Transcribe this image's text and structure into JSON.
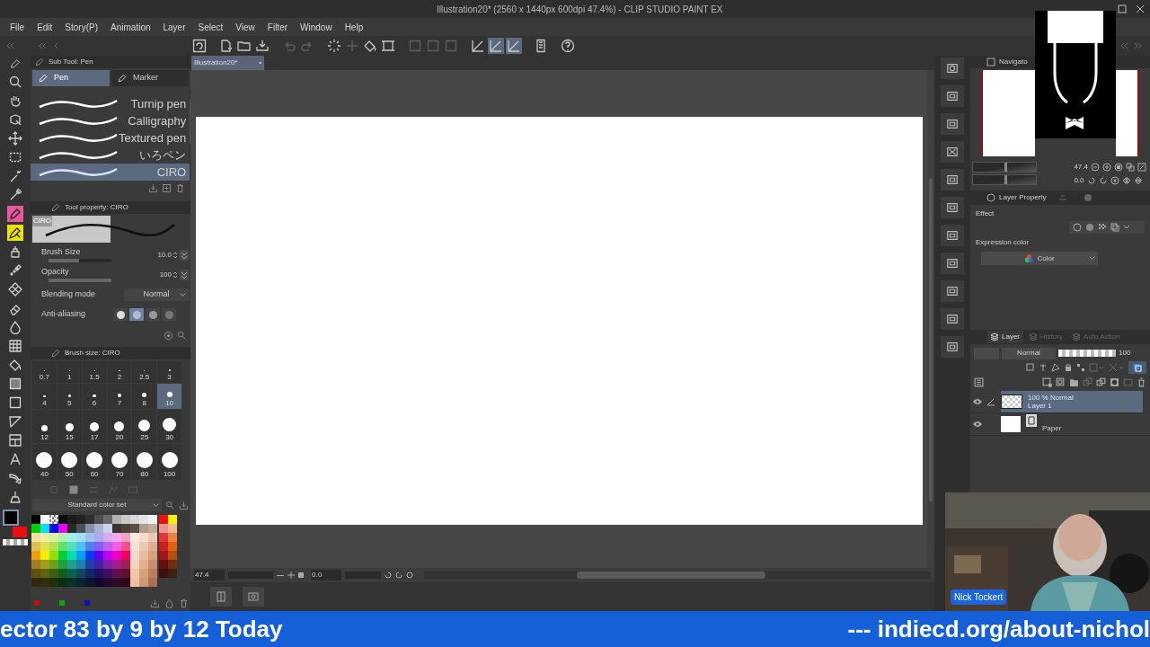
{
  "title_bar": {
    "title": "Illustration20* (2560 x 1440px 600dpi 47.4%) - CLIP STUDIO PAINT EX"
  },
  "menu": [
    "File",
    "Edit",
    "Story(P)",
    "Animation",
    "Layer",
    "Select",
    "View",
    "Filter",
    "Window",
    "Help"
  ],
  "command_bar": [
    {
      "kind": "logo",
      "disabled": false,
      "selected": false
    },
    {
      "kind": "new",
      "disabled": false,
      "selected": false
    },
    {
      "kind": "open",
      "disabled": false,
      "selected": false
    },
    {
      "kind": "save",
      "disabled": false,
      "selected": false
    },
    {
      "kind": "undo",
      "disabled": true,
      "selected": false
    },
    {
      "kind": "redo",
      "disabled": true,
      "selected": false
    },
    {
      "kind": "spinner",
      "disabled": false,
      "selected": false
    },
    {
      "kind": "cross",
      "disabled": true,
      "selected": false
    },
    {
      "kind": "fill",
      "disabled": false,
      "selected": false
    },
    {
      "kind": "selbox",
      "disabled": false,
      "selected": false
    },
    {
      "kind": "rect",
      "disabled": true,
      "selected": false
    },
    {
      "kind": "rect",
      "disabled": true,
      "selected": false
    },
    {
      "kind": "rect",
      "disabled": true,
      "selected": false
    },
    {
      "kind": "ruler",
      "disabled": false,
      "selected": false
    },
    {
      "kind": "ruler",
      "disabled": false,
      "selected": true
    },
    {
      "kind": "ruler",
      "disabled": false,
      "selected": true
    },
    {
      "kind": "device",
      "disabled": false,
      "selected": false
    },
    {
      "kind": "help",
      "disabled": false,
      "selected": false
    }
  ],
  "tools": [
    {
      "kind": "zoom"
    },
    {
      "kind": "hand"
    },
    {
      "kind": "object"
    },
    {
      "kind": "move"
    },
    {
      "kind": "select"
    },
    {
      "kind": "wand"
    },
    {
      "kind": "dropper"
    },
    {
      "kind": "pen",
      "color": "#e8589c"
    },
    {
      "kind": "pencil",
      "color": "#e8e010"
    },
    {
      "kind": "airbrush"
    },
    {
      "kind": "deco"
    },
    {
      "kind": "pattern"
    },
    {
      "kind": "eraser"
    },
    {
      "kind": "blend"
    },
    {
      "kind": "ruler"
    },
    {
      "kind": "fill"
    },
    {
      "kind": "gradient"
    },
    {
      "kind": "rect"
    },
    {
      "kind": "triangle"
    },
    {
      "kind": "frame"
    },
    {
      "kind": "text"
    },
    {
      "kind": "balloon"
    },
    {
      "kind": "correction"
    }
  ],
  "main_color": {
    "color": "#000000"
  },
  "sub_color": {
    "color": "#e81010"
  },
  "sub_tool": {
    "title": "Sub Tool: Pen",
    "tabs": [
      {
        "label": "Pen",
        "selected": true
      },
      {
        "label": "Marker",
        "selected": false
      }
    ],
    "brushes": [
      {
        "name": "Turnip pen",
        "selected": false
      },
      {
        "name": "Calligraphy",
        "selected": false
      },
      {
        "name": "Textured pen",
        "selected": false
      },
      {
        "name": "いろペン",
        "selected": false
      },
      {
        "name": "CIRO",
        "selected": true
      }
    ]
  },
  "tool_property": {
    "title": "Tool property: CIRO",
    "preview_label": "CIRO",
    "properties": [
      {
        "kind": "slider",
        "label": "Brush Size",
        "value": "10.0",
        "level": 0.48
      },
      {
        "kind": "slider",
        "label": "Opacity",
        "value": "100",
        "level": 1
      },
      {
        "kind": "dropdown",
        "label": "Blending mode",
        "value": "Normal"
      },
      {
        "kind": "options",
        "label": "Anti-aliasing",
        "options": [
          {
            "selected": false
          },
          {
            "selected": true
          },
          {
            "selected": false
          },
          {
            "selected": false
          }
        ]
      }
    ]
  },
  "brush_size": {
    "title": "Brush size: CIRO",
    "sizes": [
      {
        "label": "0.7",
        "selected": false
      },
      {
        "label": "1",
        "selected": false
      },
      {
        "label": "1.5",
        "selected": false
      },
      {
        "label": "2",
        "selected": false
      },
      {
        "label": "2.5",
        "selected": false
      },
      {
        "label": "3",
        "selected": false
      },
      {
        "label": "4",
        "selected": false
      },
      {
        "label": "5",
        "selected": false
      },
      {
        "label": "6",
        "selected": false
      },
      {
        "label": "7",
        "selected": false
      },
      {
        "label": "8",
        "selected": false
      },
      {
        "label": "10",
        "selected": true
      },
      {
        "label": "12",
        "selected": false
      },
      {
        "label": "15",
        "selected": false
      },
      {
        "label": "17",
        "selected": false
      },
      {
        "label": "20",
        "selected": false
      },
      {
        "label": "25",
        "selected": false
      },
      {
        "label": "30",
        "selected": false
      },
      {
        "label": "40",
        "selected": false
      },
      {
        "label": "50",
        "selected": false
      },
      {
        "label": "60",
        "selected": false
      },
      {
        "label": "70",
        "selected": false
      },
      {
        "label": "80",
        "selected": false
      },
      {
        "label": "100",
        "selected": false
      }
    ]
  },
  "color_set": {
    "name": "Standard color set",
    "rows": [
      [
        {
          "color": "#000000"
        },
        {
          "color": "#ffffff"
        },
        {
          "kind": "transparent"
        },
        {
          "color": "#0a0a0a"
        },
        {
          "color": "#1a1a1a"
        },
        {
          "color": "#222222"
        },
        {
          "color": "#2e2e2e"
        },
        {
          "color": "#4e4e4e"
        },
        {
          "color": "#6a6a6a"
        },
        {
          "color": "#b0b0b0"
        },
        {
          "color": "#c8c8c8"
        },
        {
          "color": "#d8d8d8"
        },
        {
          "color": "#e4e4e4"
        },
        {
          "color": "#f0f0f0"
        },
        {
          "color": "#ee1010"
        },
        {
          "color": "#f4f000"
        }
      ],
      [
        {
          "color": "#00d000"
        },
        {
          "color": "#00e0f0"
        },
        {
          "color": "#0010e0"
        },
        {
          "color": "#f000f0"
        },
        {
          "color": "#2a2a2a"
        },
        {
          "color": "#4c5058"
        },
        {
          "color": "#8890a8"
        },
        {
          "color": "#a8b4d0"
        },
        {
          "color": "#c8d4f0"
        },
        {
          "color": "#3a3430"
        },
        {
          "color": "#4c4038"
        },
        {
          "color": "#5a5048"
        },
        {
          "color": "#b09c8c"
        },
        {
          "color": "#c4aa98"
        },
        {
          "color": "#f09090"
        },
        {
          "color": "#f0b890"
        }
      ],
      [
        {
          "color": "#f0e0a0"
        },
        {
          "color": "#f0f0a0"
        },
        {
          "color": "#d8f0a0"
        },
        {
          "color": "#b0f0b0"
        },
        {
          "color": "#a0f0e0"
        },
        {
          "color": "#a0e0f0"
        },
        {
          "color": "#a0c0f0"
        },
        {
          "color": "#b0a8f0"
        },
        {
          "color": "#d8a8f0"
        },
        {
          "color": "#f0a8f0"
        },
        {
          "color": "#f0a0c0"
        },
        {
          "color": "#f8e8e0"
        },
        {
          "color": "#f4dccc"
        },
        {
          "color": "#e8c8b0"
        },
        {
          "color": "#e03838"
        },
        {
          "color": "#f08040"
        }
      ],
      [
        {
          "color": "#e0c050"
        },
        {
          "color": "#e0e050"
        },
        {
          "color": "#b0e050"
        },
        {
          "color": "#60e070"
        },
        {
          "color": "#50e0c0"
        },
        {
          "color": "#50c0f0"
        },
        {
          "color": "#5080f0"
        },
        {
          "color": "#8060f0"
        },
        {
          "color": "#c060f0"
        },
        {
          "color": "#f060e0"
        },
        {
          "color": "#f05090"
        },
        {
          "color": "#f4e0d4"
        },
        {
          "color": "#ecc8b0"
        },
        {
          "color": "#e0b090"
        },
        {
          "color": "#c82020"
        },
        {
          "color": "#e06010"
        }
      ],
      [
        {
          "color": "#f0a000"
        },
        {
          "color": "#f0f000"
        },
        {
          "color": "#90e000"
        },
        {
          "color": "#00d040"
        },
        {
          "color": "#00e0b0"
        },
        {
          "color": "#00a0f0"
        },
        {
          "color": "#0040f0"
        },
        {
          "color": "#6000f0"
        },
        {
          "color": "#c000f0"
        },
        {
          "color": "#f000c0"
        },
        {
          "color": "#f00060"
        },
        {
          "color": "#f0d8c8"
        },
        {
          "color": "#e8bc9c"
        },
        {
          "color": "#d8a07c"
        },
        {
          "color": "#a01818"
        },
        {
          "color": "#b05010"
        }
      ],
      [
        {
          "color": "#a08020"
        },
        {
          "color": "#a0a020"
        },
        {
          "color": "#70a020"
        },
        {
          "color": "#20a040"
        },
        {
          "color": "#20a090"
        },
        {
          "color": "#2080a8"
        },
        {
          "color": "#2040a8"
        },
        {
          "color": "#4020a8"
        },
        {
          "color": "#8020a8"
        },
        {
          "color": "#a02090"
        },
        {
          "color": "#a02050"
        },
        {
          "color": "#f4d4bc"
        },
        {
          "color": "#e0b090"
        },
        {
          "color": "#c89070"
        },
        {
          "color": "#601010"
        },
        {
          "color": "#703010"
        }
      ],
      [
        {
          "color": "#605010"
        },
        {
          "color": "#606010"
        },
        {
          "color": "#406010"
        },
        {
          "color": "#106020"
        },
        {
          "color": "#106050"
        },
        {
          "color": "#104860"
        },
        {
          "color": "#102860"
        },
        {
          "color": "#201060"
        },
        {
          "color": "#401060"
        },
        {
          "color": "#601050"
        },
        {
          "color": "#601030"
        },
        {
          "color": "#f0c8a8"
        },
        {
          "color": "#d8a078"
        },
        {
          "color": "#b88060"
        },
        {
          "color": "#401010"
        },
        {
          "color": "#402010"
        }
      ],
      [
        {
          "color": "#302808"
        },
        {
          "color": "#303008"
        },
        {
          "color": "#203008"
        },
        {
          "color": "#083010"
        },
        {
          "color": "#083028"
        },
        {
          "color": "#082430"
        },
        {
          "color": "#081430"
        },
        {
          "color": "#100830"
        },
        {
          "color": "#200830"
        },
        {
          "color": "#300828"
        },
        {
          "color": "#300818"
        },
        {
          "color": "#f0c0a0"
        },
        {
          "color": "#d09870"
        },
        {
          "color": "#a87050"
        }
      ]
    ]
  },
  "recent_colors": [
    {
      "color": "#c01010"
    },
    {
      "color": "#10a010"
    },
    {
      "color": "#1010c0"
    }
  ],
  "canvas_tab": {
    "label": "Illustration20*",
    "close": "•"
  },
  "canvas_status": {
    "zoom": "47.4",
    "angle": "0.0"
  },
  "navigator": {
    "title": "Navigato",
    "zoom": "47.4",
    "angle": "0.0",
    "zoom_slider": {
      "level": 0.5
    },
    "angle_slider": {
      "level": 0.5
    }
  },
  "layer_property": {
    "title": "Layer Property",
    "effect_label": "Effect",
    "expression_label": "Expression color",
    "expression_value": "Color"
  },
  "layer_panel": {
    "tabs": [
      {
        "label": "Layer",
        "selected": true
      },
      {
        "label": "History",
        "selected": false
      },
      {
        "label": "Auto Action",
        "selected": false
      }
    ],
    "blend_mode": "Normal",
    "opacity": "100",
    "opacity_slider": {
      "level": 1
    },
    "layers": [
      {
        "kind": "raster",
        "info": "100 % Normal",
        "name": "Layer 1",
        "selected": true,
        "editing": true,
        "visible": true
      },
      {
        "kind": "paper",
        "name": "Paper",
        "selected": false,
        "editing": false,
        "visible": true
      }
    ]
  },
  "webcam": {
    "name": "Nick Tockert"
  },
  "ticker": {
    "left": "ector 83 by 9 by 12 Today",
    "right": "--- indiecd.org/about-nichol"
  }
}
